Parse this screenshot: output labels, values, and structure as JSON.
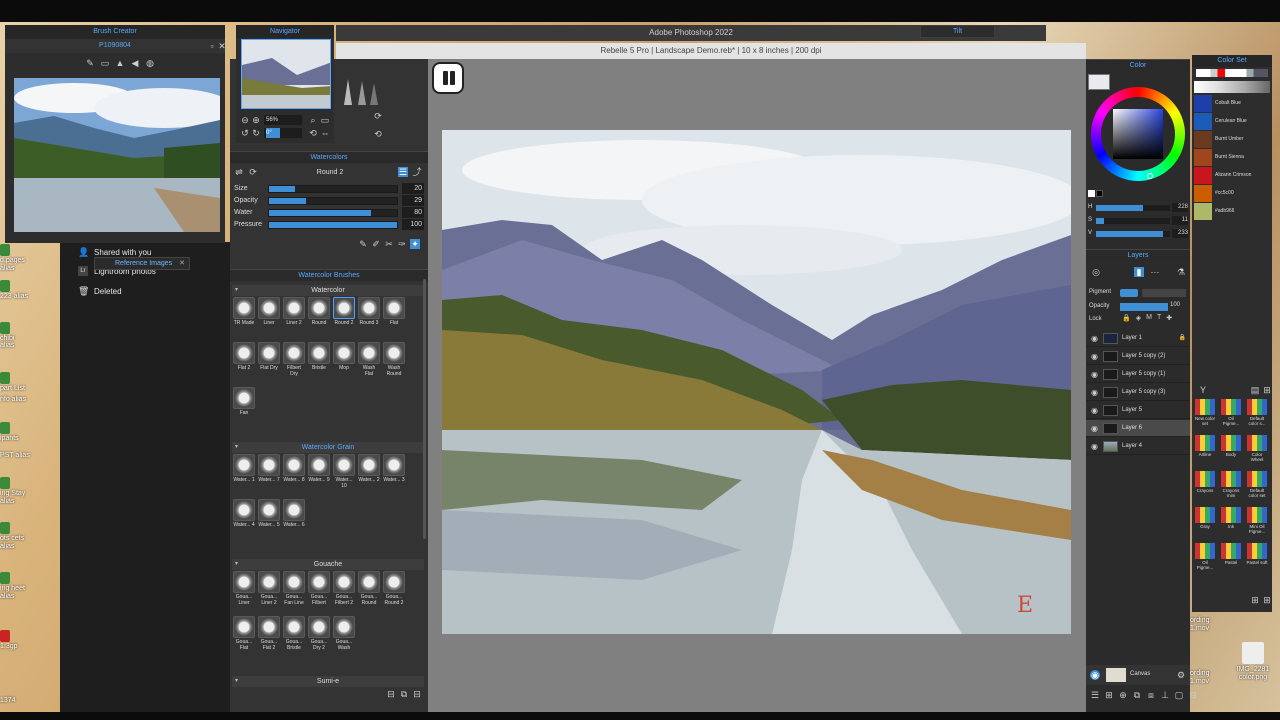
{
  "desktop": {
    "icons": [
      {
        "label": "d.pages alias"
      },
      {
        "label": "223 alias"
      },
      {
        "label": "chibi"
      },
      {
        "label": "alias"
      },
      {
        "label": "part List"
      },
      {
        "label": "nfo alias"
      },
      {
        "label": "ipants"
      },
      {
        "label": "PST alias"
      },
      {
        "label": "ing Stay alias"
      },
      {
        "label": "ots cets alias"
      },
      {
        "label": "ing heet alias"
      },
      {
        "label": "1.3gp"
      },
      {
        "label": "1374"
      }
    ],
    "right_files": [
      {
        "label": "ording 1.mov"
      },
      {
        "label": "ording 1.mov"
      },
      {
        "label": "IMG_2281 color.png"
      }
    ]
  },
  "finder": {
    "items": [
      {
        "label": "Shared with you",
        "icon": "person-icon"
      },
      {
        "label": "Lightroom photos",
        "icon": "lr-icon"
      },
      {
        "label": "Deleted",
        "icon": "trash-icon"
      }
    ],
    "reference_chip": "Reference Images"
  },
  "photoshop": {
    "title": "Adobe Photoshop 2022",
    "tilt": "Tilt"
  },
  "rebelle": {
    "title": "Rebelle 5 Pro | Landscape Demo.reb* | 10 x 8 inches | 200 dpi"
  },
  "brush_creator": {
    "title": "Brush Creator",
    "image_name": "P1090804"
  },
  "navigator": {
    "title": "Navigator",
    "zoom": "56%",
    "rotation": "0°"
  },
  "watercolors": {
    "title": "Watercolors",
    "brush_name": "Round 2",
    "sliders": [
      {
        "label": "Size",
        "value": "20",
        "fraction": 0.2
      },
      {
        "label": "Opacity",
        "value": "29",
        "fraction": 0.29
      },
      {
        "label": "Water",
        "value": "80",
        "fraction": 0.8
      },
      {
        "label": "Pressure",
        "value": "100",
        "fraction": 1.0
      }
    ]
  },
  "brush_library": {
    "title": "Watercolor Brushes",
    "sections": [
      {
        "name": "Watercolor",
        "brushes": [
          "TR Made",
          "Liner",
          "Liner 2",
          "Round",
          "Round 2",
          "Round 3",
          "Flat",
          "Flat 2",
          "Flat Dry",
          "Filbert Dry",
          "Bristle",
          "Mop",
          "Wash Flat",
          "Wash Round",
          "Fan"
        ],
        "selected": "Round 2"
      },
      {
        "name": "Watercolor Grain",
        "brushes": [
          "Water... 1",
          "Water... 7",
          "Water... 8",
          "Water... 9",
          "Water... 10",
          "Water... 2",
          "Water... 3",
          "Water... 4",
          "Water... 5",
          "Water... 6"
        ]
      },
      {
        "name": "Gouache",
        "brushes": [
          "Goua... Liner",
          "Goua... Liner 2",
          "Goua... Fan Line",
          "Goua... Filbert",
          "Goua... Filbert 2",
          "Goua... Round",
          "Goua... Round 2",
          "Goua... Flat",
          "Goua... Flat 2",
          "Goua... Bristle",
          "Goua... Dry 2",
          "Goua... Wash"
        ]
      },
      {
        "name": "Sumi-e",
        "brushes": []
      }
    ]
  },
  "color_panel": {
    "title": "Color",
    "hsv": [
      {
        "label": "H",
        "value": "228",
        "fraction": 0.63
      },
      {
        "label": "S",
        "value": "11",
        "fraction": 0.11
      },
      {
        "label": "V",
        "value": "233",
        "fraction": 0.91
      }
    ],
    "current_color": "#e8eaf0"
  },
  "layers_panel": {
    "title": "Layers",
    "pigment_label": "Pigment",
    "opacity_label": "Opacity",
    "opacity_value": "100",
    "lock_label": "Lock",
    "layers": [
      {
        "name": "Layer 1",
        "locked": true
      },
      {
        "name": "Layer 5 copy (2)"
      },
      {
        "name": "Layer 5 copy (1)"
      },
      {
        "name": "Layer 5 copy (3)"
      },
      {
        "name": "Layer 5"
      },
      {
        "name": "Layer 6",
        "selected": true
      },
      {
        "name": "Layer 4"
      }
    ],
    "canvas_label": "Canvas"
  },
  "color_set": {
    "title": "Color Set",
    "swatches": [
      {
        "name": "Cobalt Blue",
        "color": "#1f3fa8"
      },
      {
        "name": "Cerulean Blue",
        "color": "#1c5bb8"
      },
      {
        "name": "Burnt Umber",
        "color": "#6b3a1e"
      },
      {
        "name": "Burnt Sienna",
        "color": "#a0461c"
      },
      {
        "name": "Alizarin Crimson",
        "color": "#c8161c"
      },
      {
        "name": "#cc5c00",
        "color": "#cc5c00"
      },
      {
        "name": "#adb966",
        "color": "#adb966"
      }
    ],
    "sets": [
      "New color set",
      "Oil Pigme...",
      "Default color s...",
      "Artline",
      "Body",
      "Color Wheel",
      "Crayons",
      "Crayons mini",
      "Default color set",
      "Gray",
      "Ink",
      "Mini Oil Pigme...",
      "Oil Pigme...",
      "Pastel",
      "Pastel soft"
    ]
  }
}
